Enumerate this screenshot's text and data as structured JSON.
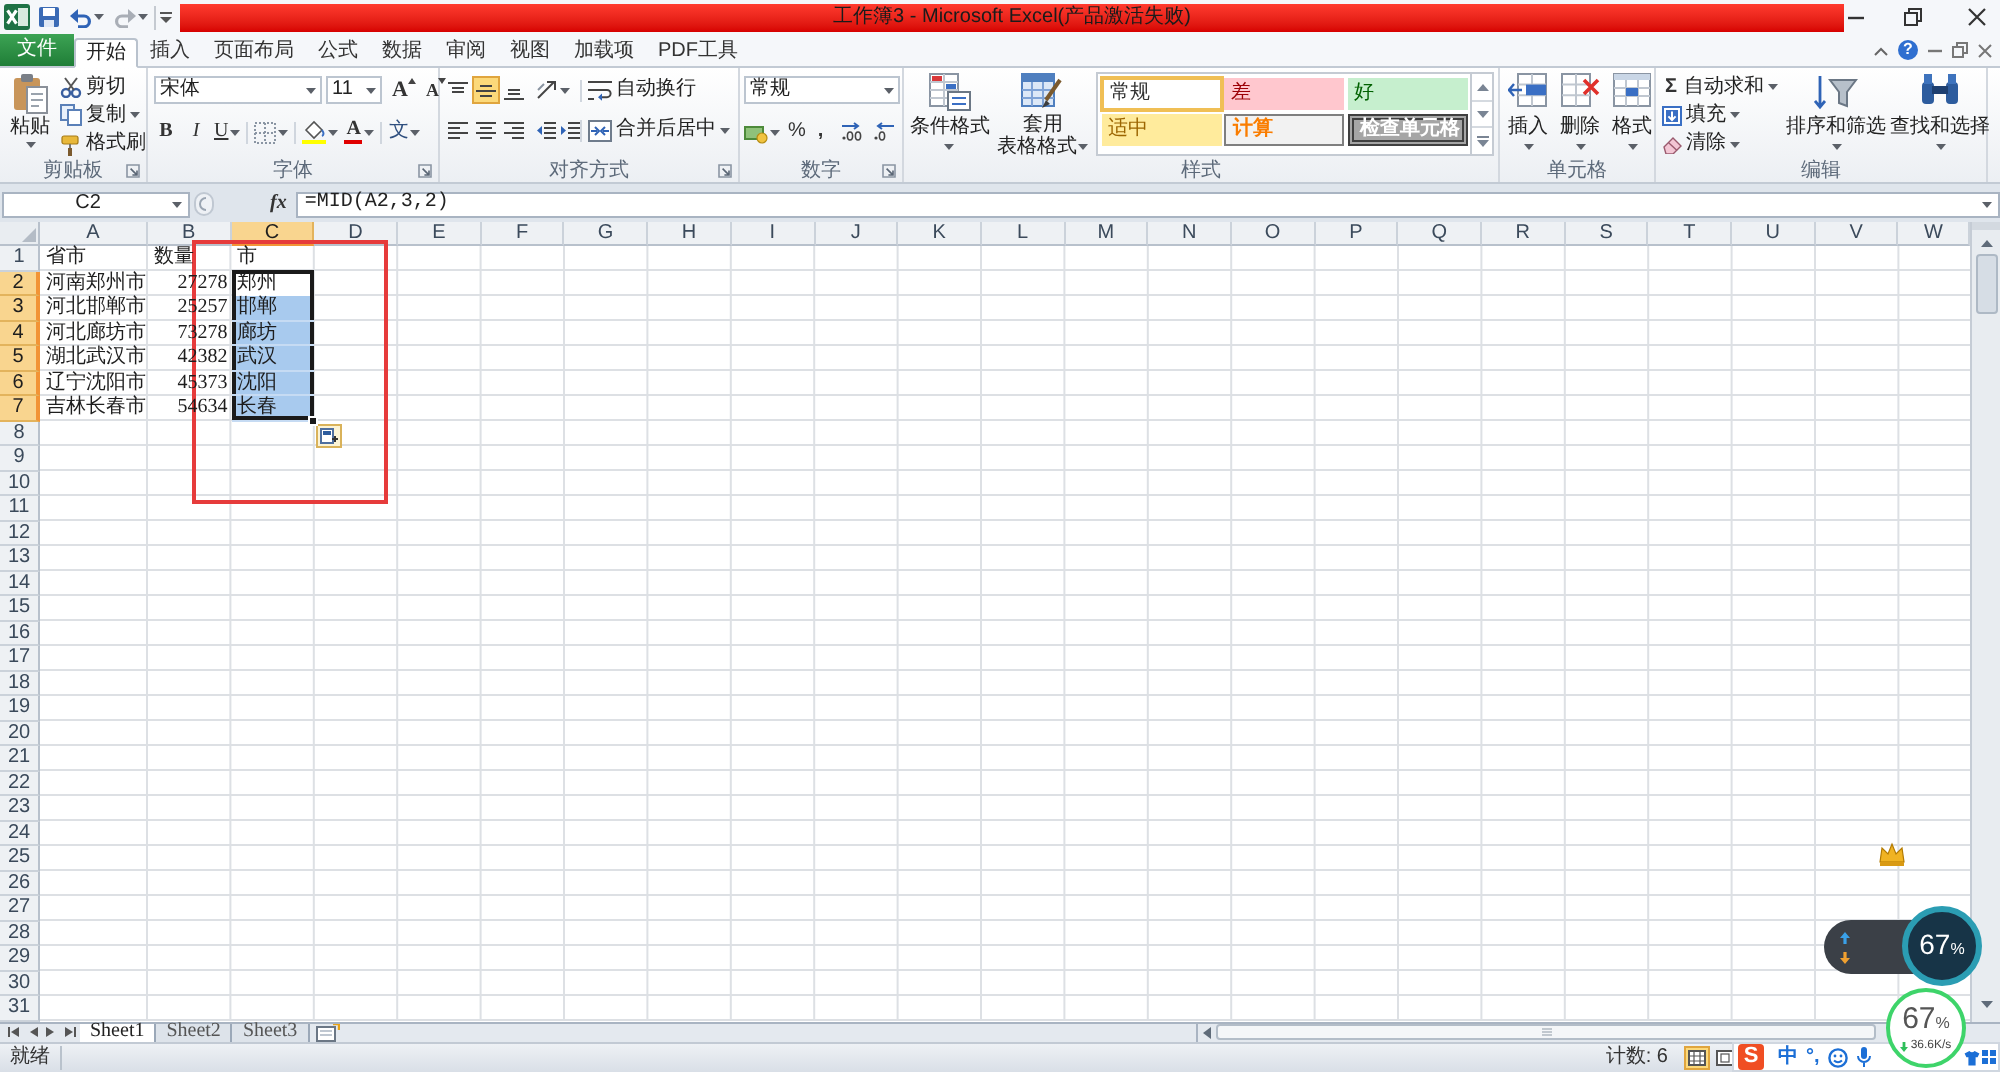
{
  "title_bar": {
    "title": "工作簿3 - Microsoft Excel(产品激活失败)"
  },
  "ribbon_tabs": [
    {
      "label": "文件",
      "kind": "file",
      "selected": false
    },
    {
      "label": "开始",
      "kind": "tab",
      "selected": true
    },
    {
      "label": "插入",
      "kind": "tab",
      "selected": false
    },
    {
      "label": "页面布局",
      "kind": "tab",
      "selected": false
    },
    {
      "label": "公式",
      "kind": "tab",
      "selected": false
    },
    {
      "label": "数据",
      "kind": "tab",
      "selected": false
    },
    {
      "label": "审阅",
      "kind": "tab",
      "selected": false
    },
    {
      "label": "视图",
      "kind": "tab",
      "selected": false
    },
    {
      "label": "加载项",
      "kind": "tab",
      "selected": false
    },
    {
      "label": "PDF工具",
      "kind": "tab",
      "selected": false
    }
  ],
  "ribbon_help": "?",
  "clipboard": {
    "label": "剪贴板",
    "paste": "粘贴",
    "cut": "剪切",
    "copy": "复制",
    "format_painter": "格式刷"
  },
  "font": {
    "label": "字体",
    "font_name": "宋体",
    "font_size": "11",
    "grow": "A",
    "shrink": "A",
    "bold": "B",
    "italic": "I",
    "underline": "U",
    "font_color": "A",
    "phonetic": "文"
  },
  "alignment": {
    "label": "对齐方式",
    "vertical": [
      {
        "selected": false
      },
      {
        "selected": true
      },
      {
        "selected": false
      }
    ],
    "horizontal": [
      {
        "selected": false
      },
      {
        "selected": false
      },
      {
        "selected": false
      }
    ],
    "wrap_text": "自动换行",
    "merge_center": "合并后居中"
  },
  "number": {
    "label": "数字",
    "format": "常规",
    "percent": "%",
    "comma": ","
  },
  "styles": {
    "label": "样式",
    "conditional_formatting": "条件格式",
    "format_as_table": [
      "套用",
      "表格格式"
    ],
    "gallery": [
      {
        "label": "常规",
        "kind": "normal",
        "selected": true
      },
      {
        "label": "差",
        "kind": "bad",
        "selected": false
      },
      {
        "label": "好",
        "kind": "good",
        "selected": false
      },
      {
        "label": "适中",
        "kind": "neutral",
        "selected": false
      },
      {
        "label": "计算",
        "kind": "calculation",
        "selected": false
      },
      {
        "label": "检查单元格",
        "kind": "check",
        "selected": false
      }
    ]
  },
  "cells": {
    "label": "单元格",
    "buttons": [
      {
        "label": "插入",
        "kind": "insert"
      },
      {
        "label": "删除",
        "kind": "delete"
      },
      {
        "label": "格式",
        "kind": "format"
      }
    ]
  },
  "editing": {
    "label": "编辑",
    "small": [
      {
        "kind": "autosum",
        "symbol": "Σ",
        "label": "自动求和"
      },
      {
        "kind": "fill",
        "label": "填充"
      },
      {
        "kind": "clear",
        "label": "清除"
      }
    ],
    "large": [
      {
        "kind": "sort",
        "label": "排序和筛选"
      },
      {
        "kind": "find",
        "label": "查找和选择"
      }
    ]
  },
  "formula_bar": {
    "name_box": "C2",
    "insert_function": "fx",
    "formula": "=MID(A2,3,2)"
  },
  "sheet": {
    "columns": [
      {
        "label": "A",
        "selected": false
      },
      {
        "label": "B",
        "selected": false
      },
      {
        "label": "C",
        "selected": true
      },
      {
        "label": "D",
        "selected": false
      },
      {
        "label": "E",
        "selected": false
      },
      {
        "label": "F",
        "selected": false
      },
      {
        "label": "G",
        "selected": false
      },
      {
        "label": "H",
        "selected": false
      },
      {
        "label": "I",
        "selected": false
      },
      {
        "label": "J",
        "selected": false
      },
      {
        "label": "K",
        "selected": false
      },
      {
        "label": "L",
        "selected": false
      },
      {
        "label": "M",
        "selected": false
      },
      {
        "label": "N",
        "selected": false
      },
      {
        "label": "O",
        "selected": false
      },
      {
        "label": "P",
        "selected": false
      },
      {
        "label": "Q",
        "selected": false
      },
      {
        "label": "R",
        "selected": false
      },
      {
        "label": "S",
        "selected": false
      },
      {
        "label": "T",
        "selected": false
      },
      {
        "label": "U",
        "selected": false
      },
      {
        "label": "V",
        "selected": false
      },
      {
        "label": "W",
        "selected": false
      }
    ],
    "rows": [
      {
        "label": "1",
        "selected": false,
        "cells": [
          {
            "text": "省市",
            "kind": "text",
            "selected": false,
            "active": false
          },
          {
            "text": "数量",
            "kind": "text",
            "selected": false,
            "active": false
          },
          {
            "text": "市",
            "kind": "text",
            "selected": false,
            "active": false
          }
        ]
      },
      {
        "label": "2",
        "selected": true,
        "cells": [
          {
            "text": "河南郑州市",
            "kind": "text",
            "selected": false,
            "active": false
          },
          {
            "text": "27278",
            "kind": "number",
            "selected": false,
            "active": false
          },
          {
            "text": "郑州",
            "kind": "text",
            "selected": true,
            "active": true
          }
        ]
      },
      {
        "label": "3",
        "selected": true,
        "cells": [
          {
            "text": "河北邯郸市",
            "kind": "text",
            "selected": false,
            "active": false
          },
          {
            "text": "25257",
            "kind": "number",
            "selected": false,
            "active": false
          },
          {
            "text": "邯郸",
            "kind": "text",
            "selected": true,
            "active": false
          }
        ]
      },
      {
        "label": "4",
        "selected": true,
        "cells": [
          {
            "text": "河北廊坊市",
            "kind": "text",
            "selected": false,
            "active": false
          },
          {
            "text": "73278",
            "kind": "number",
            "selected": false,
            "active": false
          },
          {
            "text": "廊坊",
            "kind": "text",
            "selected": true,
            "active": false
          }
        ]
      },
      {
        "label": "5",
        "selected": true,
        "cells": [
          {
            "text": "湖北武汉市",
            "kind": "text",
            "selected": false,
            "active": false
          },
          {
            "text": "42382",
            "kind": "number",
            "selected": false,
            "active": false
          },
          {
            "text": "武汉",
            "kind": "text",
            "selected": true,
            "active": false
          }
        ]
      },
      {
        "label": "6",
        "selected": true,
        "cells": [
          {
            "text": "辽宁沈阳市",
            "kind": "text",
            "selected": false,
            "active": false
          },
          {
            "text": "45373",
            "kind": "number",
            "selected": false,
            "active": false
          },
          {
            "text": "沈阳",
            "kind": "text",
            "selected": true,
            "active": false
          }
        ]
      },
      {
        "label": "7",
        "selected": true,
        "cells": [
          {
            "text": "吉林长春市",
            "kind": "text",
            "selected": false,
            "active": false
          },
          {
            "text": "54634",
            "kind": "number",
            "selected": false,
            "active": false
          },
          {
            "text": "长春",
            "kind": "text",
            "selected": true,
            "active": false
          }
        ]
      },
      {
        "label": "8",
        "selected": false
      },
      {
        "label": "9",
        "selected": false
      },
      {
        "label": "10",
        "selected": false
      },
      {
        "label": "11",
        "selected": false
      },
      {
        "label": "12",
        "selected": false
      },
      {
        "label": "13",
        "selected": false
      },
      {
        "label": "14",
        "selected": false
      },
      {
        "label": "15",
        "selected": false
      },
      {
        "label": "16",
        "selected": false
      },
      {
        "label": "17",
        "selected": false
      },
      {
        "label": "18",
        "selected": false
      },
      {
        "label": "19",
        "selected": false
      },
      {
        "label": "20",
        "selected": false
      },
      {
        "label": "21",
        "selected": false
      },
      {
        "label": "22",
        "selected": false
      },
      {
        "label": "23",
        "selected": false
      },
      {
        "label": "24",
        "selected": false
      },
      {
        "label": "25",
        "selected": false
      },
      {
        "label": "26",
        "selected": false
      },
      {
        "label": "27",
        "selected": false
      },
      {
        "label": "28",
        "selected": false
      },
      {
        "label": "29",
        "selected": false
      },
      {
        "label": "30",
        "selected": false
      },
      {
        "label": "31",
        "selected": false
      }
    ]
  },
  "sheet_tabs": [
    {
      "label": "Sheet1",
      "selected": true
    },
    {
      "label": "Sheet2",
      "selected": false
    },
    {
      "label": "Sheet3",
      "selected": false
    }
  ],
  "status_bar": {
    "mode": "就绪",
    "count": "计数: 6",
    "views": [
      {
        "kind": "normal",
        "selected": true
      },
      {
        "kind": "page_layout",
        "selected": false
      }
    ]
  },
  "ime_toolbar": {
    "logo": "S",
    "language": "中",
    "punctuation": "°,"
  },
  "network_widgets": [
    {
      "kind": "dark",
      "percent": "67",
      "unit": "%"
    },
    {
      "kind": "light",
      "percent": "67",
      "unit": "%",
      "speed": "36.6K/s"
    }
  ]
}
